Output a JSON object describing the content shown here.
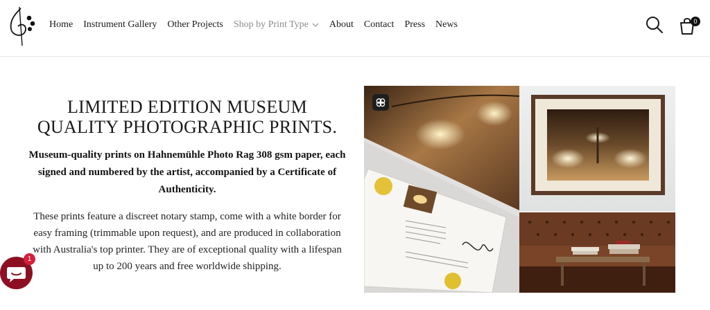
{
  "header": {
    "logo_name": "treble-clef-logo",
    "nav": [
      {
        "label": "Home",
        "muted": false,
        "dropdown": false
      },
      {
        "label": "Instrument Gallery",
        "muted": false,
        "dropdown": false
      },
      {
        "label": "Other Projects",
        "muted": false,
        "dropdown": false
      },
      {
        "label": "Shop by Print Type",
        "muted": true,
        "dropdown": true
      },
      {
        "label": "About",
        "muted": false,
        "dropdown": false
      },
      {
        "label": "Contact",
        "muted": false,
        "dropdown": false
      },
      {
        "label": "Press",
        "muted": false,
        "dropdown": false
      },
      {
        "label": "News",
        "muted": false,
        "dropdown": false
      }
    ],
    "cart_count": "0"
  },
  "hero": {
    "title_line1": "LIMITED EDITION MUSEUM",
    "title_line2": "QUALITY PHOTOGRAPHIC PRINTS.",
    "lead": "Museum-quality prints on Hahnemühle Photo Rag 308 gsm paper, each signed and numbered by the artist, accompanied by a Certificate of Authenticity.",
    "body": "These prints feature a discreet notary stamp, come with a white border for easy framing (trimmable upon request), and are produced in collaboration with Australia's top printer. They are of exceptional quality with a lifespan up to 200 years and free worldwide shipping."
  },
  "chat": {
    "badge_count": "1"
  },
  "colors": {
    "chat_bubble": "#8c1022",
    "chat_badge": "#d61f3a",
    "muted_nav": "#8c8c8c",
    "text": "#1a1a1a"
  }
}
